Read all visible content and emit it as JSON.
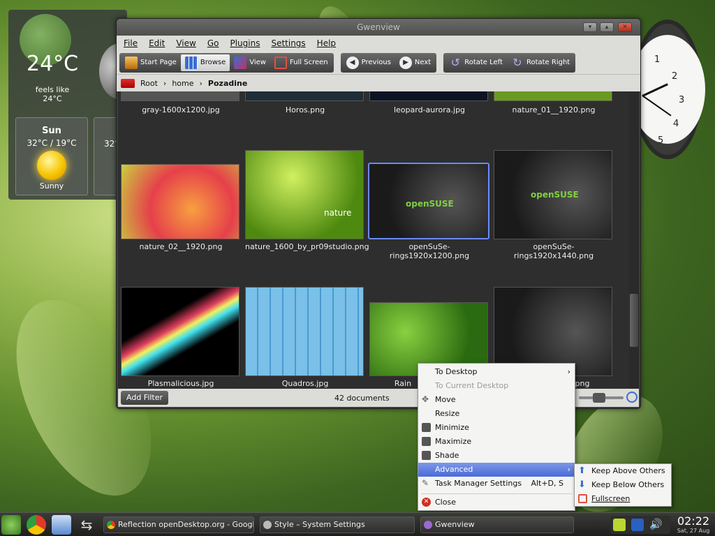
{
  "weather": {
    "temp": "24°C",
    "feels": "feels like 24°C",
    "day": "Sun",
    "range": "32°C / 19°C",
    "condition": "Sunny",
    "day2_partial": "32°"
  },
  "clock": {
    "numerals": [
      "1",
      "2",
      "3",
      "4",
      "5"
    ]
  },
  "window": {
    "title": "Gwenview",
    "menu": [
      "File",
      "Edit",
      "View",
      "Go",
      "Plugins",
      "Settings",
      "Help"
    ],
    "toolbar": {
      "start_page": "Start Page",
      "browse": "Browse",
      "view": "View",
      "fullscreen": "Full Screen",
      "previous": "Previous",
      "next": "Next",
      "rotate_left": "Rotate Left",
      "rotate_right": "Rotate Right"
    },
    "breadcrumb": [
      "Root",
      "home",
      "Pozadine"
    ],
    "thumbs_row1": [
      "gray-1600x1200.jpg",
      "Horos.png",
      "leopard-aurora.jpg",
      "nature_01__1920.png"
    ],
    "thumbs_row2": [
      "nature_02__1920.png",
      "nature_1600_by_pr09studio.png",
      "openSuSe-rings1920x1200.png",
      "openSuSe-rings1920x1440.png"
    ],
    "thumbs_row3": [
      "Plasmalicious.jpg",
      "Quadros.jpg",
      "Rain",
      "png"
    ],
    "thumb_text": {
      "nature": "nature",
      "opensuse": "openSUSE"
    },
    "status": {
      "add_filter": "Add Filter",
      "count": "42 documents"
    }
  },
  "context_menu": {
    "items": [
      "To Desktop",
      "To Current Desktop",
      "Move",
      "Resize",
      "Minimize",
      "Maximize",
      "Shade",
      "Advanced",
      "Task Manager Settings",
      "Close"
    ],
    "shortcut": "Alt+D, S",
    "submenu": [
      "Keep Above Others",
      "Keep Below Others",
      "Fullscreen"
    ]
  },
  "taskbar": {
    "tasks": [
      "Reflection openDesktop.org - Google Chrome",
      "Style – System Settings",
      "Gwenview"
    ],
    "time": "02:22",
    "date": "Sat, 27 Aug"
  }
}
